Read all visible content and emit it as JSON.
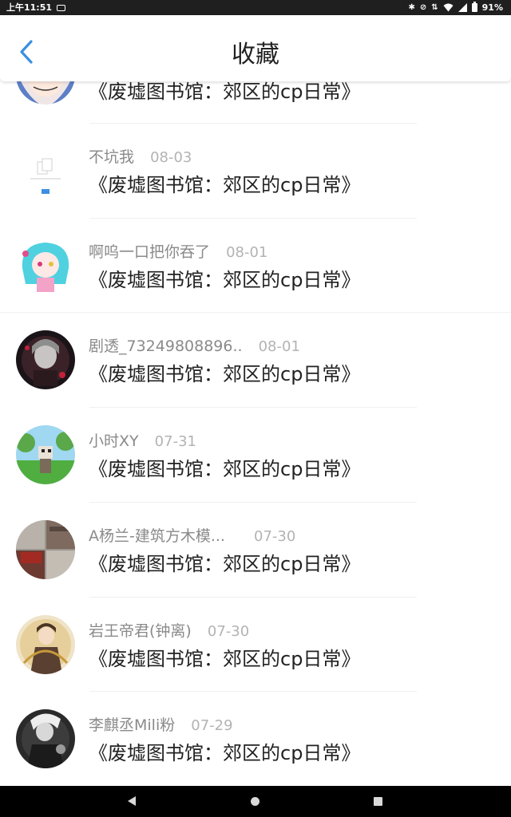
{
  "status_bar": {
    "time": "上午11:51",
    "battery": "91%",
    "icons": [
      "tv-icon",
      "bluetooth-icon",
      "mute-icon",
      "data-arrows-icon",
      "wifi-icon",
      "signal-icon",
      "battery-icon"
    ]
  },
  "header": {
    "title": "收藏",
    "back_icon": "chevron-left-icon",
    "accent_color": "#3d8fe0"
  },
  "favorites": [
    {
      "user": "",
      "date": "",
      "title": "《废墟图书馆：郊区的cp日常》",
      "avatar": "anime-girl-blue-hair"
    },
    {
      "user": "不坑我",
      "date": "08-03",
      "title": "《废墟图书馆：郊区的cp日常》",
      "avatar": "document-placeholder"
    },
    {
      "user": "啊呜一口把你吞了",
      "date": "08-01",
      "title": "《废墟图书馆：郊区的cp日常》",
      "avatar": "cyan-hair-girl"
    },
    {
      "user": "剧透_73249808896..",
      "date": "08-01",
      "title": "《废墟图书馆：郊区的cp日常》",
      "avatar": "dark-red-character"
    },
    {
      "user": "小时XY",
      "date": "07-31",
      "title": "《废墟图书馆：郊区的cp日常》",
      "avatar": "pixel-character-grass"
    },
    {
      "user": "A杨兰-建筑方木模...",
      "date": "07-30",
      "title": "《废墟图书馆：郊区的cp日常》",
      "avatar": "construction-photo"
    },
    {
      "user": "岩王帝君(钟离)",
      "date": "07-30",
      "title": "《废墟图书馆：郊区的cp日常》",
      "avatar": "golden-character"
    },
    {
      "user": "李麒丞Mili粉",
      "date": "07-29",
      "title": "《废墟图书馆：郊区的cp日常》",
      "avatar": "monochrome-character"
    }
  ],
  "nav_bar": {
    "icons": [
      "back-triangle-icon",
      "home-circle-icon",
      "recents-square-icon"
    ]
  }
}
